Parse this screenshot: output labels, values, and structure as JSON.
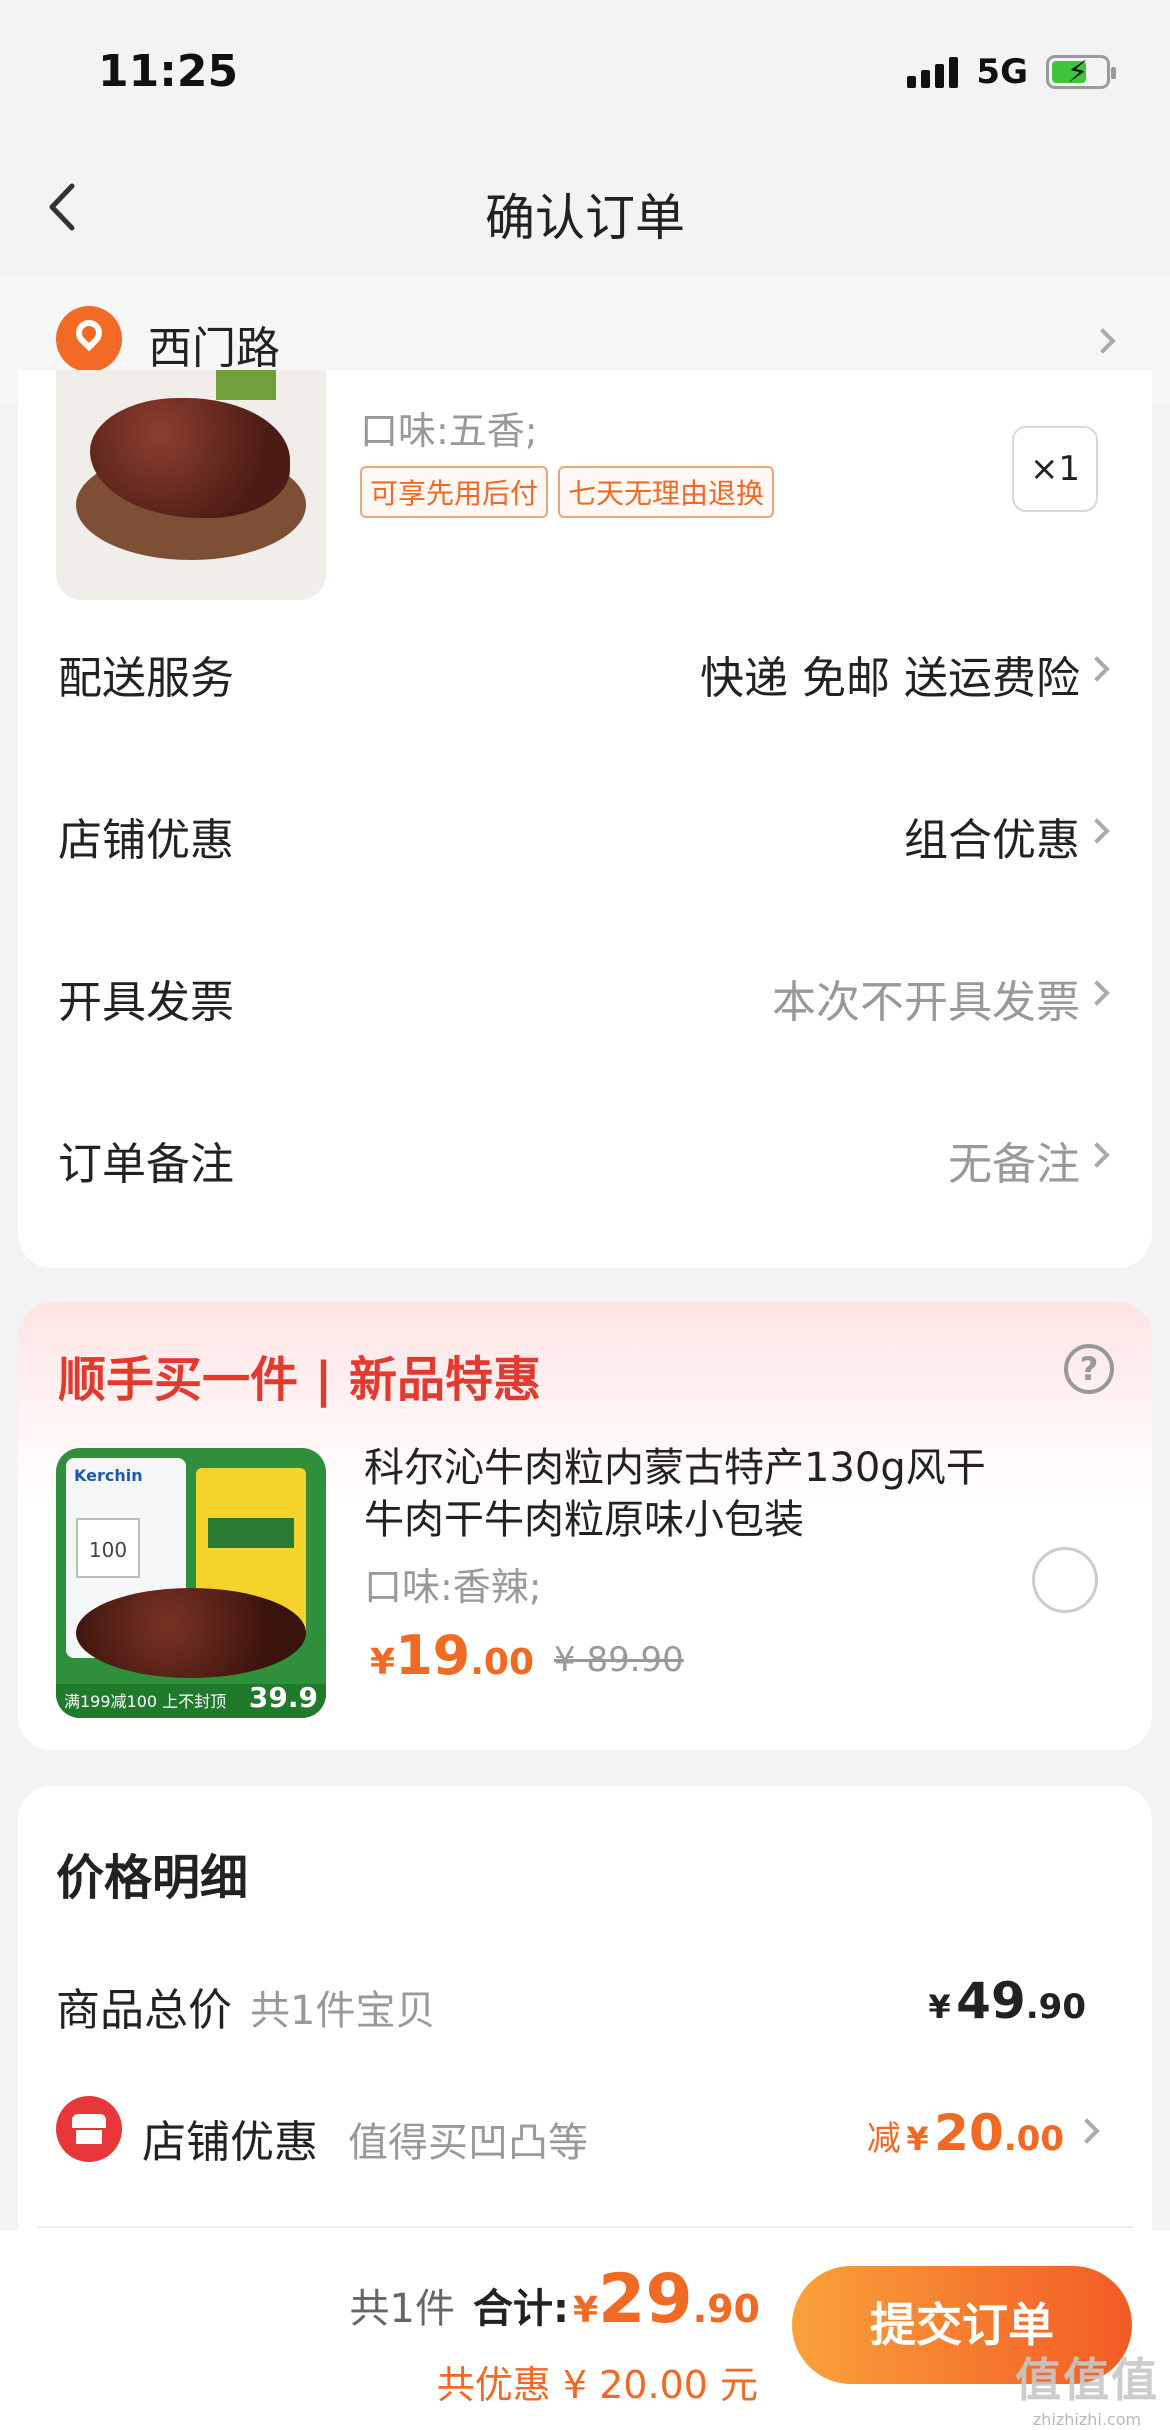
{
  "status_bar": {
    "time": "11:25",
    "network": "5G",
    "battery_icon": "battery-charging-icon"
  },
  "nav": {
    "title": "确认订单",
    "back_icon": "back-arrow-icon"
  },
  "address": {
    "text": "西门路",
    "icon": "location-pin-icon"
  },
  "order_item": {
    "flavor": "口味:五香;",
    "tags": [
      "可享先用后付",
      "七天无理由退换"
    ],
    "quantity": "×1"
  },
  "options": [
    {
      "label": "配送服务",
      "value": "快递 免邮 送运费险"
    },
    {
      "label": "店铺优惠",
      "value": "组合优惠"
    },
    {
      "label": "开具发票",
      "value": "本次不开具发票"
    },
    {
      "label": "订单备注",
      "value": "无备注"
    }
  ],
  "promo": {
    "title": "顺手买一件 | 新品特惠",
    "product": {
      "title": "科尔沁牛肉粒内蒙古特产130g风干牛肉干牛肉粒原味小包装",
      "flavor": "口味:香辣;",
      "price_symbol": "¥",
      "price_int": "19",
      "price_dec": ".00",
      "original_price": "¥ 89.90",
      "image_brand": "Kerchin",
      "image_coupon": "100",
      "image_strip": "满199减100 上不封顶",
      "image_price": "39.9"
    }
  },
  "price_detail": {
    "title": "价格明细",
    "goods_total": {
      "label": "商品总价",
      "sub": "共1件宝贝",
      "symbol": "¥",
      "int": "49",
      "dec": ".90"
    },
    "shop_discount": {
      "label": "店铺优惠",
      "sub": "值得买凹凸等",
      "prefix": "减",
      "symbol": "¥",
      "int": "20",
      "dec": ".00"
    }
  },
  "bottom_bar": {
    "count": "共1件",
    "total_label": "合计:",
    "total_symbol": "¥",
    "total_int": "29",
    "total_dec": ".90",
    "saved": "共优惠 ¥ 20.00 元",
    "submit": "提交订单",
    "watermark": "值值值",
    "watermark_url": "zhizhizhi.com"
  },
  "colors": {
    "accent": "#f06a24",
    "promo_red": "#e23a2e",
    "button_start": "#f9a23a",
    "button_end": "#f25a25"
  }
}
